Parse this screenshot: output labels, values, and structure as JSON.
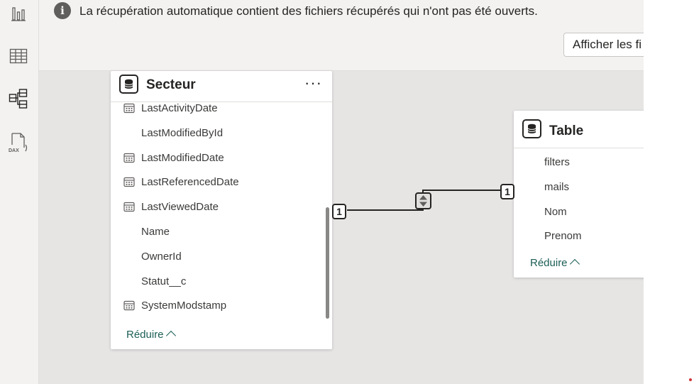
{
  "infobar": {
    "message": "La récupération automatique contient des fichiers récupérés qui n'ont pas été ouverts.",
    "button_label": "Afficher les fi"
  },
  "rail": {
    "icons": [
      "report-view-icon",
      "table-view-icon",
      "model-view-icon",
      "dax-query-view-icon"
    ],
    "dax_label": "DAX"
  },
  "secteur": {
    "title": "Secteur",
    "more": "···",
    "fields": [
      {
        "name": "LastActivityDate",
        "icon": "calendar-icon"
      },
      {
        "name": "LastModifiedById",
        "icon": ""
      },
      {
        "name": "LastModifiedDate",
        "icon": "calendar-icon"
      },
      {
        "name": "LastReferencedDate",
        "icon": "calendar-icon"
      },
      {
        "name": "LastViewedDate",
        "icon": "calendar-icon"
      },
      {
        "name": "Name",
        "icon": ""
      },
      {
        "name": "OwnerId",
        "icon": ""
      },
      {
        "name": "Statut__c",
        "icon": ""
      },
      {
        "name": "SystemModstamp",
        "icon": "calendar-icon"
      }
    ],
    "collapse_label": "Réduire"
  },
  "table": {
    "title": "Table",
    "fields": [
      {
        "name": "filters"
      },
      {
        "name": "mails"
      },
      {
        "name": "Nom"
      },
      {
        "name": "Prenom"
      }
    ],
    "collapse_label": "Réduire"
  },
  "relationship": {
    "from_cardinality": "1",
    "to_cardinality": "1",
    "direction": "both",
    "direction_icon": "cross-filter-both-icon"
  },
  "colors": {
    "accent": "#1b5e56",
    "canvas": "#e6e5e4",
    "alert": "#d13438"
  }
}
